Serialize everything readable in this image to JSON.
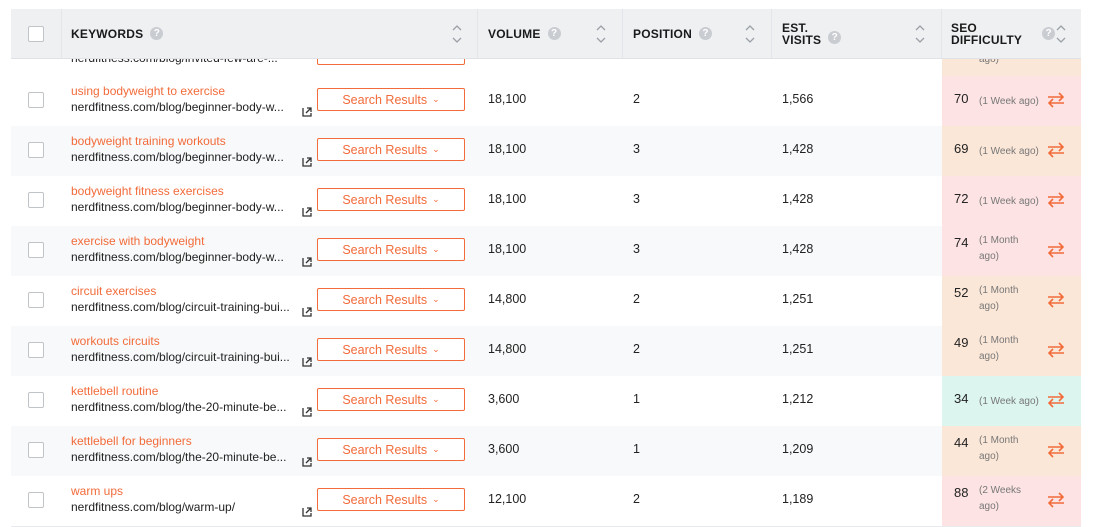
{
  "header": {
    "keywords": "KEYWORDS",
    "volume": "VOLUME",
    "position": "POSITION",
    "est_visits_1": "EST.",
    "est_visits_2": "VISITS",
    "seo_1": "SEO",
    "seo_2": "DIFFICULTY",
    "help": "?"
  },
  "partial_row": {
    "url": "nerdfitness.com/blog/invited-few-are-...",
    "when": "ago)"
  },
  "rows": [
    {
      "keyword": "using bodyweight to exercise",
      "url": "nerdfitness.com/blog/beginner-body-w...",
      "button": "Search Results",
      "volume": "18,100",
      "position": "2",
      "visits": "1,566",
      "score": "70",
      "when": "(1 Week ago)",
      "bg": "#fde3e3"
    },
    {
      "keyword": "bodyweight training workouts",
      "url": "nerdfitness.com/blog/beginner-body-w...",
      "button": "Search Results",
      "volume": "18,100",
      "position": "3",
      "visits": "1,428",
      "score": "69",
      "when": "(1 Week ago)",
      "bg": "#fbe7d8"
    },
    {
      "keyword": "bodyweight fitness exercises",
      "url": "nerdfitness.com/blog/beginner-body-w...",
      "button": "Search Results",
      "volume": "18,100",
      "position": "3",
      "visits": "1,428",
      "score": "72",
      "when": "(1 Week ago)",
      "bg": "#fde3e3"
    },
    {
      "keyword": "exercise with bodyweight",
      "url": "nerdfitness.com/blog/beginner-body-w...",
      "button": "Search Results",
      "volume": "18,100",
      "position": "3",
      "visits": "1,428",
      "score": "74",
      "when": "(1 Month ago)",
      "bg": "#fde3e3"
    },
    {
      "keyword": "circuit exercises",
      "url": "nerdfitness.com/blog/circuit-training-bui...",
      "button": "Search Results",
      "volume": "14,800",
      "position": "2",
      "visits": "1,251",
      "score": "52",
      "when": "(1 Month ago)",
      "bg": "#fbe7d8"
    },
    {
      "keyword": "workouts circuits",
      "url": "nerdfitness.com/blog/circuit-training-bui...",
      "button": "Search Results",
      "volume": "14,800",
      "position": "2",
      "visits": "1,251",
      "score": "49",
      "when": "(1 Month ago)",
      "bg": "#fbe7d8"
    },
    {
      "keyword": "kettlebell routine",
      "url": "nerdfitness.com/blog/the-20-minute-be...",
      "button": "Search Results",
      "volume": "3,600",
      "position": "1",
      "visits": "1,212",
      "score": "34",
      "when": "(1 Week ago)",
      "bg": "#dcf5ee"
    },
    {
      "keyword": "kettlebell for beginners",
      "url": "nerdfitness.com/blog/the-20-minute-be...",
      "button": "Search Results",
      "volume": "3,600",
      "position": "1",
      "visits": "1,209",
      "score": "44",
      "when": "(1 Month ago)",
      "bg": "#fbe7d8"
    },
    {
      "keyword": "warm ups",
      "url": "nerdfitness.com/blog/warm-up/",
      "button": "Search Results",
      "volume": "12,100",
      "position": "2",
      "visits": "1,189",
      "score": "88",
      "when": "(2 Weeks ago)",
      "bg": "#fde3e3"
    }
  ],
  "colors": {
    "accent": "#f26b3a",
    "header_bg": "#eef0f2"
  },
  "icons": {
    "swap": "swap-arrows-icon",
    "external": "external-link-icon",
    "sort": "sort-arrows-icon"
  }
}
